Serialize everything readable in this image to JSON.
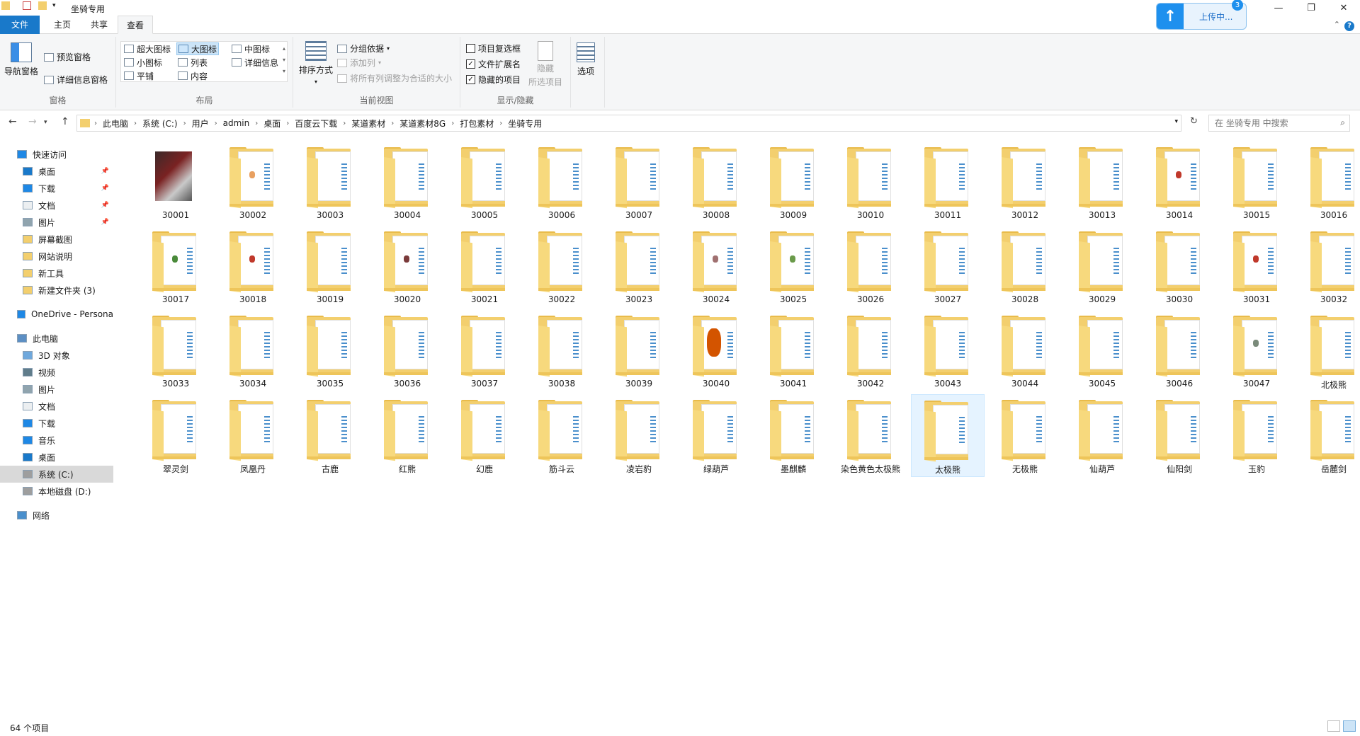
{
  "window": {
    "title": "坐骑专用",
    "controls": {
      "minimize": "—",
      "maximize": "❐",
      "close": "✕"
    }
  },
  "upload": {
    "label": "上传中...",
    "badge": "3"
  },
  "ribbon_tabs": [
    {
      "label": "文件"
    },
    {
      "label": "主页"
    },
    {
      "label": "共享"
    },
    {
      "label": "查看"
    }
  ],
  "ribbon": {
    "pane_group": {
      "label": "窗格",
      "nav_pane": "导航窗格",
      "preview_pane": "预览窗格",
      "details_pane": "详细信息窗格"
    },
    "layout_group": {
      "label": "布局",
      "items": [
        "超大图标",
        "大图标",
        "中图标",
        "小图标",
        "列表",
        "详细信息",
        "平铺",
        "内容"
      ],
      "selected": "大图标"
    },
    "view_group": {
      "label": "当前视图",
      "sort": "排序方式",
      "group_by": "分组依据",
      "add_column": "添加列",
      "fit_columns": "将所有列调整为合适的大小"
    },
    "showhide_group": {
      "label": "显示/隐藏",
      "checkbox_items": {
        "label": "项目复选框",
        "checked": false
      },
      "file_ext": {
        "label": "文件扩展名",
        "checked": true
      },
      "hidden_items": {
        "label": "隐藏的项目",
        "checked": true
      },
      "hide_selected": [
        "隐藏",
        "所选项目"
      ]
    },
    "options": "选项"
  },
  "address": {
    "breadcrumbs": [
      "此电脑",
      "系统 (C:)",
      "用户",
      "admin",
      "桌面",
      "百度云下载",
      "某道素材",
      "某道素材8G",
      "打包素材",
      "坐骑专用"
    ],
    "search_placeholder": "在 坐骑专用 中搜索"
  },
  "nav_pane": {
    "items": [
      {
        "label": "快速访问",
        "icon": "star-icon",
        "pinned": false,
        "level": 0
      },
      {
        "label": "桌面",
        "icon": "desktop-icon",
        "pinned": true,
        "level": 1
      },
      {
        "label": "下载",
        "icon": "download-icon",
        "pinned": true,
        "level": 1
      },
      {
        "label": "文档",
        "icon": "document-icon",
        "pinned": true,
        "level": 1
      },
      {
        "label": "图片",
        "icon": "picture-icon",
        "pinned": true,
        "level": 1
      },
      {
        "label": "屏幕截图",
        "icon": "folder-icon",
        "pinned": false,
        "level": 1
      },
      {
        "label": "网站说明",
        "icon": "folder-icon",
        "pinned": false,
        "level": 1
      },
      {
        "label": "新工具",
        "icon": "folder-icon",
        "pinned": false,
        "level": 1
      },
      {
        "label": "新建文件夹 (3)",
        "icon": "folder-icon",
        "pinned": false,
        "level": 1
      },
      {
        "label": "OneDrive - Persona",
        "icon": "cloud-icon",
        "pinned": false,
        "level": 0
      },
      {
        "label": "此电脑",
        "icon": "computer-icon",
        "pinned": false,
        "level": 0
      },
      {
        "label": "3D 对象",
        "icon": "cube-icon",
        "pinned": false,
        "level": 1
      },
      {
        "label": "视频",
        "icon": "video-icon",
        "pinned": false,
        "level": 1
      },
      {
        "label": "图片",
        "icon": "picture-icon",
        "pinned": false,
        "level": 1
      },
      {
        "label": "文档",
        "icon": "document-icon",
        "pinned": false,
        "level": 1
      },
      {
        "label": "下载",
        "icon": "download-icon",
        "pinned": false,
        "level": 1
      },
      {
        "label": "音乐",
        "icon": "music-icon",
        "pinned": false,
        "level": 1
      },
      {
        "label": "桌面",
        "icon": "desktop-icon",
        "pinned": false,
        "level": 1
      },
      {
        "label": "系统 (C:)",
        "icon": "drive-icon",
        "pinned": false,
        "level": 1,
        "selected": true
      },
      {
        "label": "本地磁盘 (D:)",
        "icon": "drive-icon",
        "pinned": false,
        "level": 1
      },
      {
        "label": "网络",
        "icon": "network-icon",
        "pinned": false,
        "level": 0
      }
    ]
  },
  "folders": [
    "30001",
    "30002",
    "30003",
    "30004",
    "30005",
    "30006",
    "30007",
    "30008",
    "30009",
    "30010",
    "30011",
    "30012",
    "30013",
    "30014",
    "30015",
    "30016",
    "30017",
    "30018",
    "30019",
    "30020",
    "30021",
    "30022",
    "30023",
    "30024",
    "30025",
    "30026",
    "30027",
    "30028",
    "30029",
    "30030",
    "30031",
    "30032",
    "30033",
    "30034",
    "30035",
    "30036",
    "30037",
    "30038",
    "30039",
    "30040",
    "30041",
    "30042",
    "30043",
    "30044",
    "30045",
    "30046",
    "30047",
    "北极熊",
    "翠灵剑",
    "凤凰丹",
    "古鹿",
    "红熊",
    "幻鹿",
    "筋斗云",
    "凌岩豹",
    "绿葫芦",
    "墨麒麟",
    "染色黄色太极熊",
    "太极熊",
    "无极熊",
    "仙葫芦",
    "仙阳剑",
    "玉豹",
    "岳麓剑"
  ],
  "selected_folder": "太极熊",
  "status": {
    "item_count": "64 个项目"
  }
}
